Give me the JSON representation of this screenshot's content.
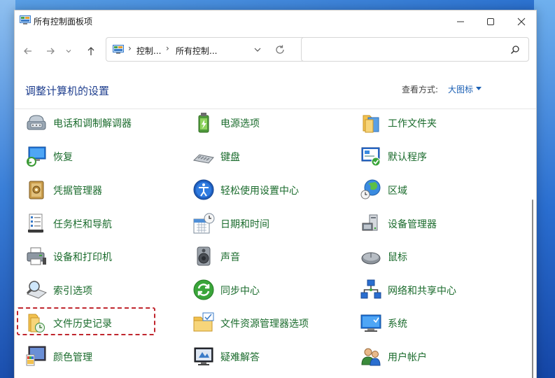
{
  "window": {
    "title": "所有控制面板项"
  },
  "address": {
    "crumbs": [
      "控制...",
      "所有控制..."
    ],
    "separator": "›",
    "search_placeholder": ""
  },
  "header": {
    "title": "调整计算机的设置",
    "view_by_label": "查看方式:",
    "view_by_value": "大图标"
  },
  "items": [
    {
      "label": "电话和调制解调器",
      "icon": "phone-modem-icon"
    },
    {
      "label": "电源选项",
      "icon": "power-options-icon"
    },
    {
      "label": "工作文件夹",
      "icon": "work-folders-icon"
    },
    {
      "label": "恢复",
      "icon": "recovery-icon"
    },
    {
      "label": "键盘",
      "icon": "keyboard-icon"
    },
    {
      "label": "默认程序",
      "icon": "default-programs-icon"
    },
    {
      "label": "凭据管理器",
      "icon": "credential-manager-icon"
    },
    {
      "label": "轻松使用设置中心",
      "icon": "ease-of-access-icon"
    },
    {
      "label": "区域",
      "icon": "region-icon"
    },
    {
      "label": "任务栏和导航",
      "icon": "taskbar-icon"
    },
    {
      "label": "日期和时间",
      "icon": "date-time-icon"
    },
    {
      "label": "设备管理器",
      "icon": "device-manager-icon"
    },
    {
      "label": "设备和打印机",
      "icon": "devices-printers-icon"
    },
    {
      "label": "声音",
      "icon": "sound-icon"
    },
    {
      "label": "鼠标",
      "icon": "mouse-icon"
    },
    {
      "label": "索引选项",
      "icon": "indexing-icon"
    },
    {
      "label": "同步中心",
      "icon": "sync-center-icon"
    },
    {
      "label": "网络和共享中心",
      "icon": "network-sharing-icon"
    },
    {
      "label": "文件历史记录",
      "icon": "file-history-icon"
    },
    {
      "label": "文件资源管理器选项",
      "icon": "explorer-options-icon"
    },
    {
      "label": "系统",
      "icon": "system-icon"
    },
    {
      "label": "颜色管理",
      "icon": "color-management-icon"
    },
    {
      "label": "疑难解答",
      "icon": "troubleshooting-icon"
    },
    {
      "label": "用户帐户",
      "icon": "user-accounts-icon"
    }
  ],
  "colors": {
    "item_label": "#1a6b2c",
    "heading": "#1e3e8e",
    "link": "#1a5fb4",
    "highlight": "#c0262e"
  }
}
